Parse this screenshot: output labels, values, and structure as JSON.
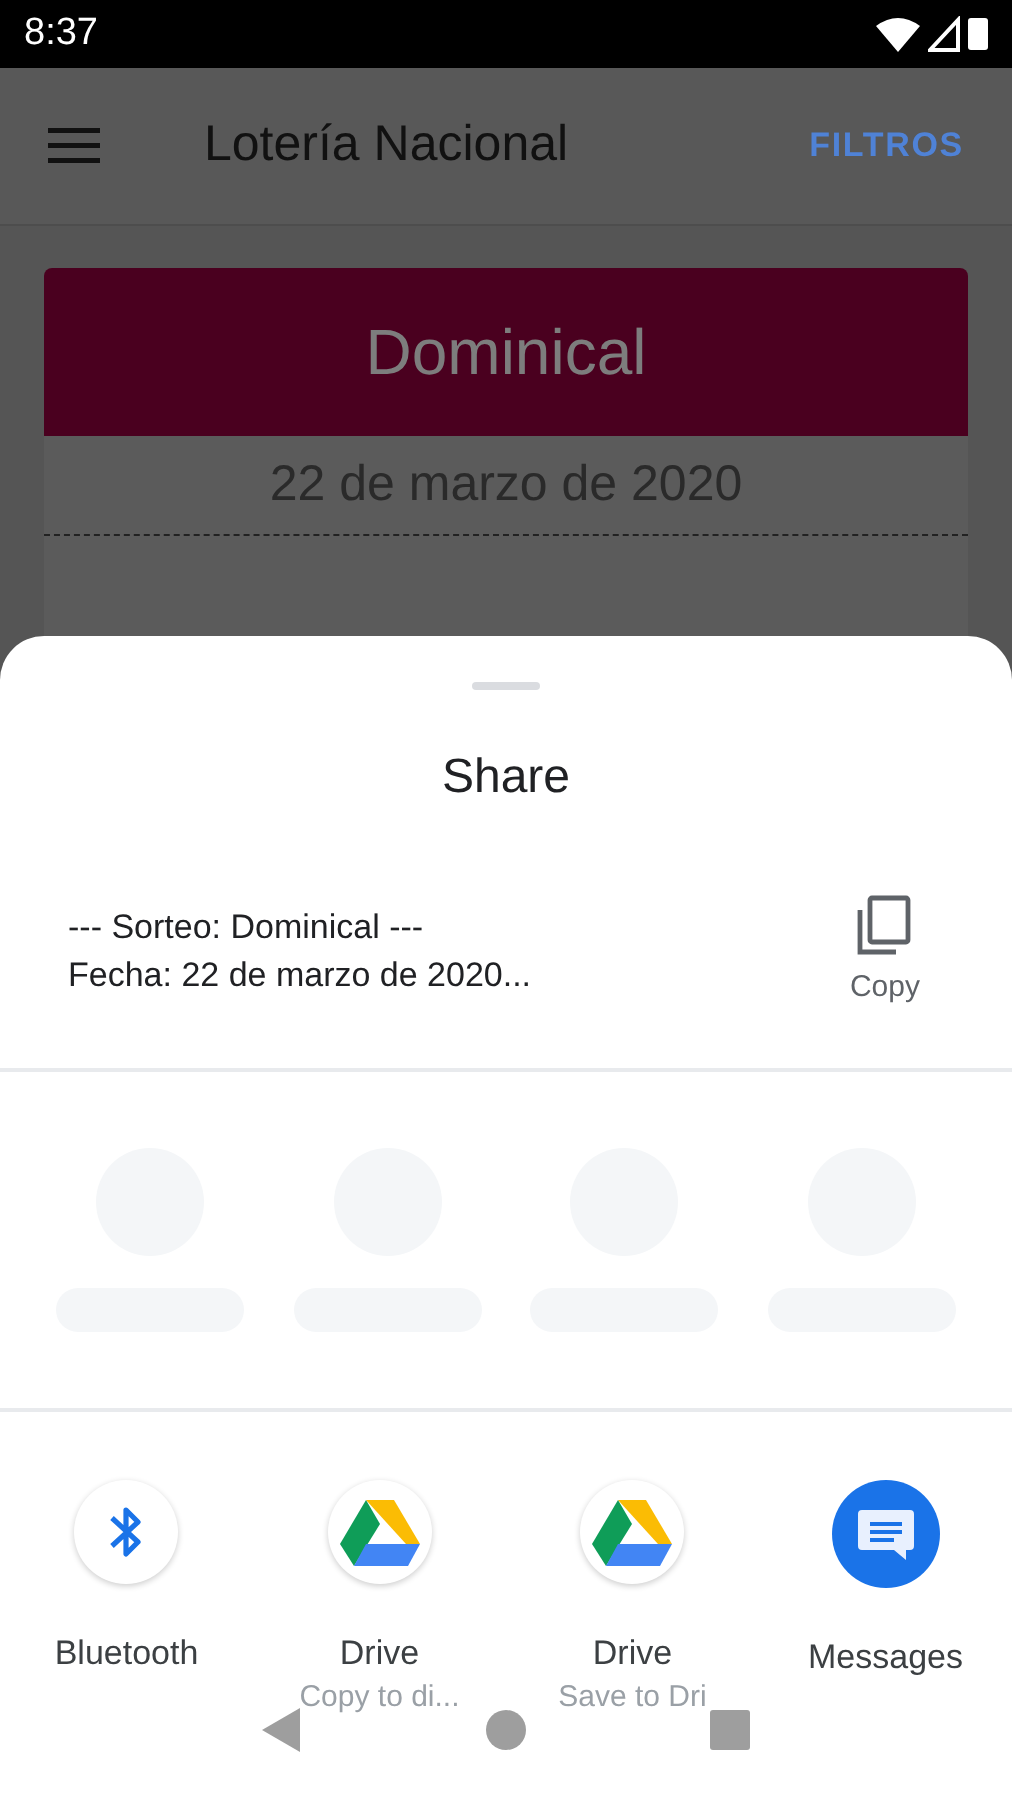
{
  "status_bar": {
    "time": "8:37"
  },
  "app_bar": {
    "title": "Lotería Nacional",
    "action": "FILTROS"
  },
  "card": {
    "draw_name": "Dominical",
    "date": "22 de marzo de 2020"
  },
  "share_sheet": {
    "title": "Share",
    "preview_lines": [
      "--- Sorteo: Dominical ---",
      "Fecha: 22 de marzo de 2020..."
    ],
    "copy_label": "Copy",
    "apps": [
      {
        "kind": "bluetooth",
        "label": "Bluetooth"
      },
      {
        "kind": "drive",
        "label": "Drive",
        "sublabel": "Copy to di..."
      },
      {
        "kind": "drive",
        "label": "Drive",
        "sublabel": "Save to Dri"
      },
      {
        "kind": "messages",
        "label": "Messages"
      }
    ]
  }
}
